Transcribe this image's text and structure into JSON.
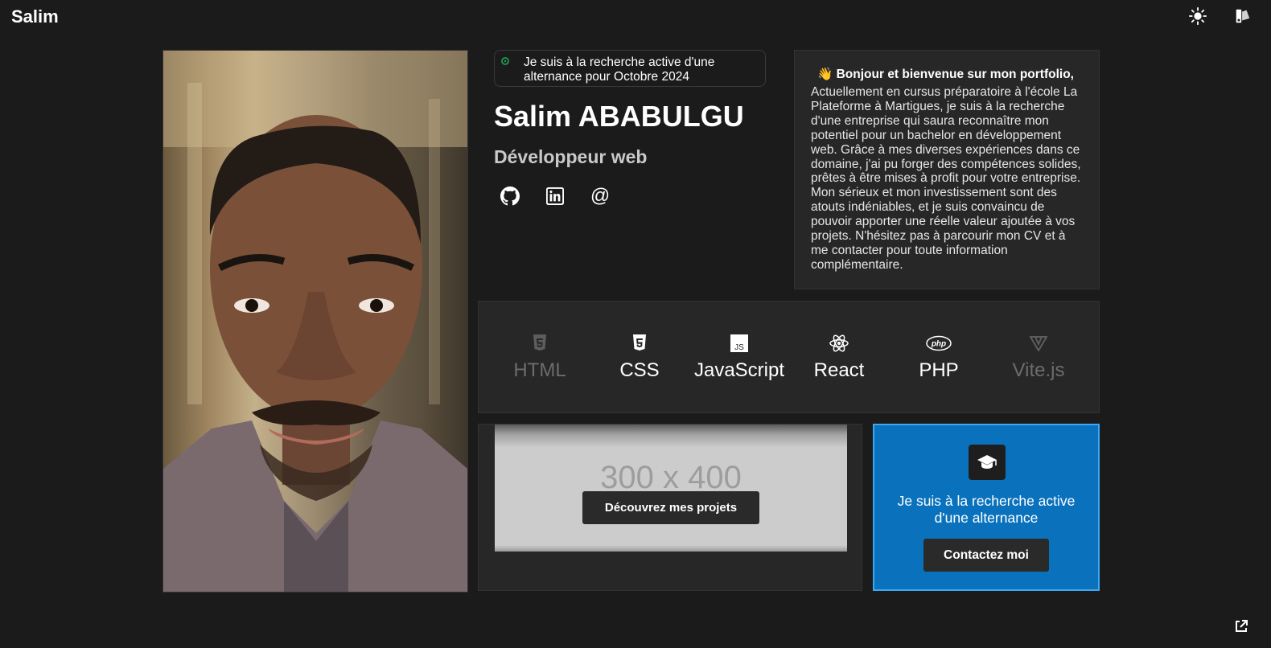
{
  "header": {
    "brand": "Salim"
  },
  "profile": {
    "status": "Je suis à la recherche active d'une alternance pour Octobre 2024",
    "name": "Salim ABABULGU",
    "role": "Développeur web",
    "socials": [
      "github-icon",
      "linkedin-icon",
      "@"
    ]
  },
  "welcome": {
    "title": "👋 Bonjour et bienvenue sur mon portfolio,",
    "body": "Actuellement en cursus préparatoire à l'école La Plateforme à Martigues, je suis à la recherche d'une entreprise qui saura reconnaître mon potentiel pour un bachelor en développement web. Grâce à mes diverses expériences dans ce domaine, j'ai pu forger des compétences solides, prêtes à être mises à profit pour votre entreprise. Mon sérieux et mon investissement sont des atouts indéniables, et je suis convaincu de pouvoir apporter une réelle valeur ajoutée à vos projets. N'hésitez pas à parcourir mon CV et à me contacter pour toute information complémentaire."
  },
  "skills": [
    {
      "label": "HTML",
      "icon": "html5-icon"
    },
    {
      "label": "CSS",
      "icon": "css3-icon"
    },
    {
      "label": "JavaScript",
      "icon": "js-icon"
    },
    {
      "label": "React",
      "icon": "react-icon"
    },
    {
      "label": "PHP",
      "icon": "php-icon"
    },
    {
      "label": "Vite.js",
      "icon": "vite-icon"
    }
  ],
  "projects": {
    "placeholder": "300 x 400",
    "button": "Découvrez mes projets"
  },
  "alternance": {
    "text": "Je suis à la recherche active d'une alternance",
    "button": "Contactez moi"
  },
  "colors": {
    "background": "#1b1b1b",
    "card": "#272727",
    "accent": "#0a72bd",
    "status": "#2bd46a"
  }
}
